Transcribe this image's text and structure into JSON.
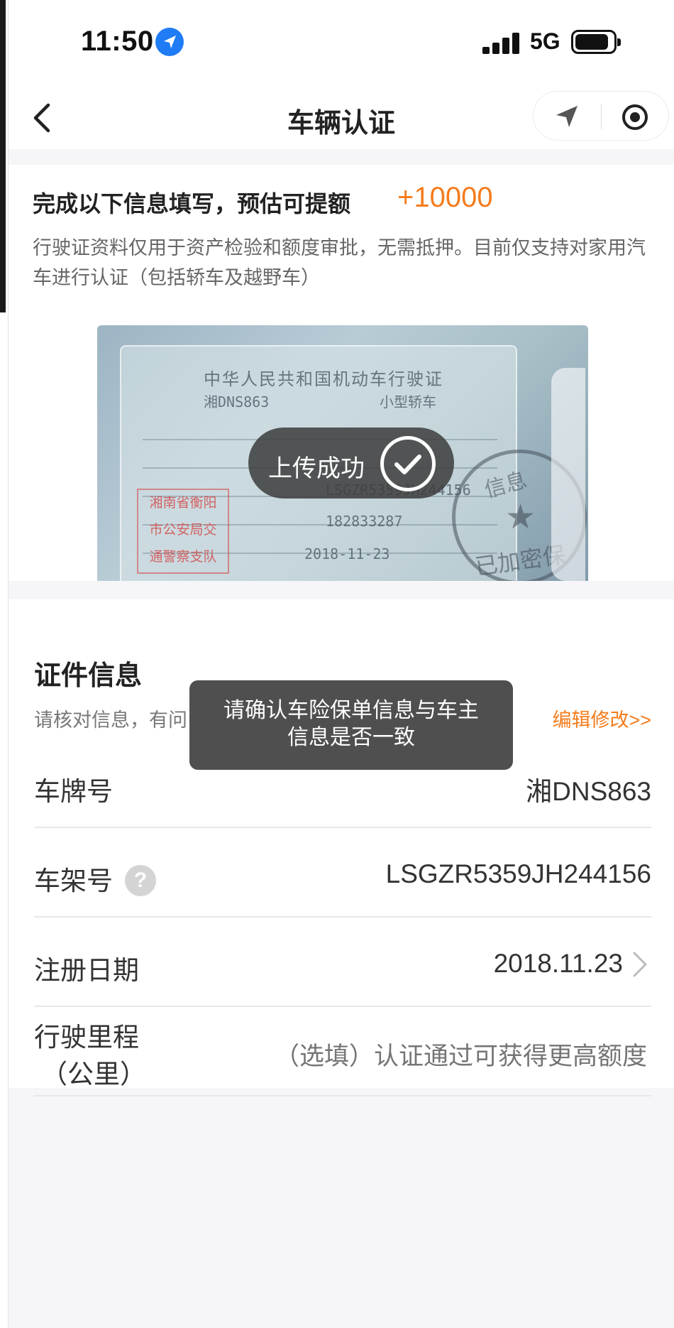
{
  "status_bar": {
    "time": "11:50",
    "network": "5G",
    "icons": [
      "location-arrow-icon",
      "signal-icon",
      "battery-icon"
    ]
  },
  "nav": {
    "title": "车辆认证",
    "icons": [
      "back-arrow-icon",
      "location-arrow-icon",
      "target-icon"
    ]
  },
  "intro": {
    "headline": "完成以下信息填写，预估可提额",
    "amount": "+10000",
    "description": "行驶证资料仅用于资产检验和额度审批，无需抵押。目前仅支持对家用汽车进行认证（包括轿车及越野车）"
  },
  "license_image": {
    "title_cn": "中华人民共和国机动车行驶证",
    "plate": "湘DNS863",
    "vehicle_type": "小型轿车",
    "vin": "LSGZR5359JH244156",
    "engine_no": "182833287",
    "reg_date": "2018-11-23",
    "stamp_text_top": "信息",
    "stamp_text_bottom": "已加密保护",
    "seal_lines": [
      "湘南省衡阳",
      "市公安局交",
      "通警察支队"
    ],
    "upload_text": "上传成功"
  },
  "certificate": {
    "title": "证件信息",
    "hint": "请核对信息，有问",
    "edit_link": "编辑修改>>",
    "rows": [
      {
        "label": "车牌号",
        "value": "湘DNS863"
      },
      {
        "label": "车架号",
        "value": "LSGZR5359JH244156"
      },
      {
        "label": "注册日期",
        "value": "2018.11.23"
      },
      {
        "label_line1": "行驶里程",
        "label_line2": "（公里）",
        "placeholder": "（选填）认证通过可获得更高额度"
      }
    ]
  },
  "toast": {
    "line1": "请确认车险保单信息与车主",
    "line2": "信息是否一致"
  },
  "colors": {
    "accent": "#f47c1d",
    "ios_blue": "#1f7cf5",
    "toast_bg": "#3c3c3c"
  }
}
